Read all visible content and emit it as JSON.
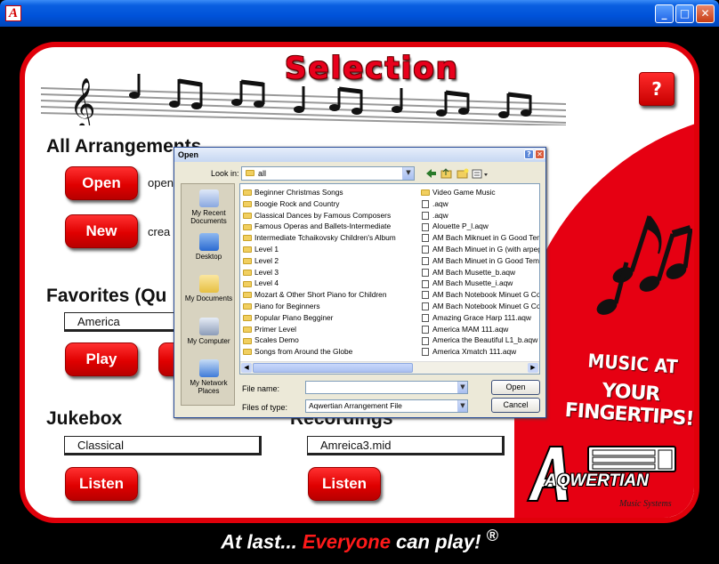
{
  "window": {
    "app_icon_letter": "A",
    "minimize_glyph": "_",
    "maximize_glyph": "□",
    "close_glyph": "✕"
  },
  "header": {
    "title": "Selection",
    "help_label": "?"
  },
  "arrangements": {
    "title": "All Arrangements",
    "open_label": "Open",
    "open_desc": "open",
    "new_label": "New",
    "new_desc": "crea"
  },
  "favorites": {
    "title": "Favorites (Qu",
    "selected": "America",
    "play_label": "Play"
  },
  "jukebox": {
    "title": "Jukebox",
    "selected": "Classical",
    "listen_label": "Listen"
  },
  "recordings": {
    "title": "Recordings",
    "selected": "Amreica3.mid",
    "listen_label": "Listen"
  },
  "branding": {
    "tagline_line1": "MUSIC AT",
    "tagline_line2": "YOUR FINGERTIPS!",
    "logo_word": "AQWERTIAN",
    "logo_sub": "Music Systems",
    "slogan_part1": "At last... ",
    "slogan_highlight": "Everyone",
    "slogan_part2": " can play! ",
    "registered": "®"
  },
  "open_dialog": {
    "title": "Open",
    "help_glyph": "?",
    "close_glyph": "✕",
    "look_in_label": "Look in:",
    "look_in_value": "all",
    "places": [
      {
        "label": "My Recent Documents"
      },
      {
        "label": "Desktop"
      },
      {
        "label": "My Documents"
      },
      {
        "label": "My Computer"
      },
      {
        "label": "My Network Places"
      }
    ],
    "column1": [
      "Beginner Christmas Songs",
      "Boogie Rock and Country",
      "Classical Dances by Famous Composers",
      "Famous Operas and Ballets-Intermediate",
      "Intermediate Tchaikovsky Children's Album",
      "Level 1",
      "Level 2",
      "Level 3",
      "Level 4",
      "Mozart  & Other Short Piano for Children",
      "Piano for Beginners",
      "Popular Piano Begginer",
      "Primer Level",
      "Scales Demo",
      "Songs from Around the Globe"
    ],
    "column2": [
      "Video Game Music",
      ".aqw",
      ".aqw",
      "Alouette P_l.aqw",
      "AM Bach Miknuet in G Good Temp",
      "AM Bach Minuet in G (with arpegg",
      "AM Bach Minuet in G Good Tempo",
      "AM Bach Musette_b.aqw",
      "AM Bach Musette_i.aqw",
      "AM Bach Notebook Minuet G Com",
      "AM Bach Notebook Minuet G Com",
      "Amazing Grace Harp 111.aqw",
      "America MAM 111.aqw",
      "America the Beautiful L1_b.aqw",
      "America Xmatch 111.aqw"
    ],
    "file_name_label": "File name:",
    "file_name_value": "",
    "files_of_type_label": "Files of type:",
    "files_of_type_value": "Aqwertian Arrangement File",
    "open_button": "Open",
    "cancel_button": "Cancel"
  }
}
